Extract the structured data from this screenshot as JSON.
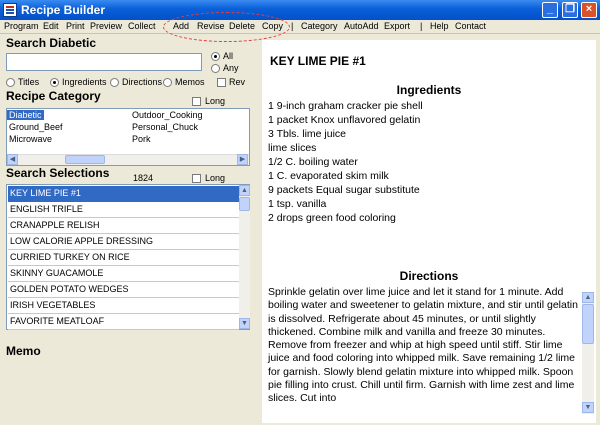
{
  "window": {
    "title": "Recipe Builder",
    "minimize": "_",
    "maximize": "❐",
    "close": "×"
  },
  "menu": [
    "Program",
    "Edit",
    "Print",
    "Preview",
    "Collect",
    "Add",
    "Revise",
    "Delete",
    "Copy",
    "|",
    "Category",
    "AutoAdd",
    "Export",
    "|",
    "Help",
    "Contact"
  ],
  "search": {
    "heading": "Search Diabetic",
    "input_value": "",
    "scope_options": [
      "All",
      "Any"
    ],
    "scope_selected": "All",
    "fields": [
      "Titles",
      "Ingredients",
      "Directions",
      "Memos",
      "Rev"
    ],
    "field_selected": "Ingredients"
  },
  "category": {
    "heading": "Recipe Category",
    "long_label": "Long",
    "col1": [
      "Diabetic",
      "Ground_Beef",
      "Microwave"
    ],
    "col2": [
      "Outdoor_Cooking",
      "Personal_Chuck",
      "Pork"
    ],
    "selected": "Diabetic"
  },
  "selections": {
    "heading": "Search Selections",
    "count": "1824",
    "long_label": "Long",
    "items": [
      "KEY LIME PIE #1",
      "ENGLISH TRIFLE",
      "CRANAPPLE RELISH",
      "LOW CALORIE APPLE DRESSING",
      "CURRIED TURKEY ON RICE",
      "SKINNY GUACAMOLE",
      "GOLDEN POTATO WEDGES",
      "IRISH VEGETABLES",
      "FAVORITE MEATLOAF"
    ],
    "selected": "KEY LIME PIE #1"
  },
  "memo": {
    "heading": "Memo"
  },
  "recipe": {
    "title": "KEY LIME PIE #1",
    "ingredients_heading": "Ingredients",
    "ingredients": [
      "1 9-inch graham cracker pie shell",
      "1 packet Knox unflavored gelatin",
      "3 Tbls. lime juice",
      "lime slices",
      "1/2 C. boiling water",
      "1 C. evaporated skim milk",
      "9 packets Equal sugar substitute",
      "1 tsp. vanilla",
      "2 drops green food coloring"
    ],
    "directions_heading": "Directions",
    "directions": "Sprinkle gelatin over lime juice and let it stand for 1 minute. Add boiling water and  sweetener to gelatin mixture, and stir until gelatin is dissolved. Refrigerate about 45  minutes, or until slightly thickened. Combine milk and vanilla and freeze 30 minutes.   Remove from freezer and whip at high speed until stiff. Stir lime juice and food coloring  into whipped milk. Save remaining 1/2 lime for garnish. Slowly blend gelatin mixture  into whipped milk. Spoon pie filling into crust. Chill until firm. Garnish with lime zest  and lime slices. Cut into"
  },
  "colors": {
    "titlebar": "#0a5fd8",
    "selection": "#316ac5",
    "face": "#ece9d8"
  }
}
